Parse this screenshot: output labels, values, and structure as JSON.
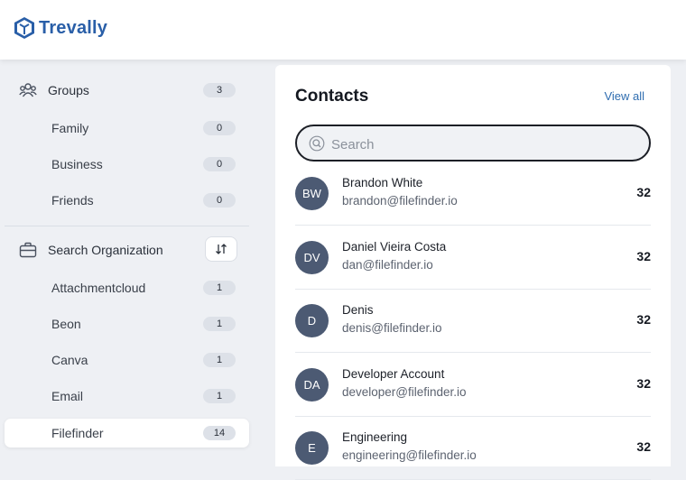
{
  "app": {
    "name": "Trevally",
    "brand_color": "#2a5fa8"
  },
  "sidebar": {
    "groups": {
      "label": "Groups",
      "count": "3",
      "icon": "users-icon"
    },
    "group_items": [
      {
        "label": "Family",
        "count": "0"
      },
      {
        "label": "Business",
        "count": "0"
      },
      {
        "label": "Friends",
        "count": "0"
      }
    ],
    "organization": {
      "label": "Search Organization",
      "icon": "briefcase-icon",
      "sort_icon": "sort-icon"
    },
    "org_items": [
      {
        "label": "Attachmentcloud",
        "count": "1"
      },
      {
        "label": "Beon",
        "count": "1"
      },
      {
        "label": "Canva",
        "count": "1"
      },
      {
        "label": "Email",
        "count": "1"
      },
      {
        "label": "Filefinder",
        "count": "14",
        "active": true
      }
    ]
  },
  "contacts": {
    "title": "Contacts",
    "view_all": "View all",
    "search_placeholder": "Search",
    "items": [
      {
        "initials": "BW",
        "name": "Brandon White",
        "email": "brandon@filefinder.io",
        "count": "32"
      },
      {
        "initials": "DV",
        "name": "Daniel Vieira Costa",
        "email": "dan@filefinder.io",
        "count": "32"
      },
      {
        "initials": "D",
        "name": "Denis",
        "email": "denis@filefinder.io",
        "count": "32"
      },
      {
        "initials": "DA",
        "name": "Developer Account",
        "email": "developer@filefinder.io",
        "count": "32"
      },
      {
        "initials": "E",
        "name": "Engineering",
        "email": "engineering@filefinder.io",
        "count": "32"
      }
    ]
  }
}
